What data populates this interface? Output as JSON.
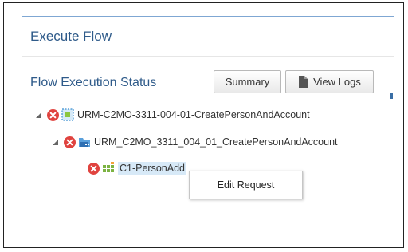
{
  "panel": {
    "title": "Execute Flow"
  },
  "status": {
    "title": "Flow Execution Status",
    "summary_label": "Summary",
    "view_logs_label": "View Logs"
  },
  "tree": {
    "nodes": [
      {
        "label": "URM-C2MO-3311-004-01-CreatePersonAndAccount",
        "icon": "flow-icon",
        "status": "error",
        "expanded": true
      },
      {
        "label": "URM_C2MO_3311_004_01_CreatePersonAndAccount",
        "icon": "folder-icon",
        "status": "error",
        "expanded": true
      },
      {
        "label": "C1-PersonAdd",
        "icon": "grid-icon",
        "status": "error",
        "selected": true
      }
    ]
  },
  "context_menu": {
    "items": [
      "Edit Request"
    ]
  },
  "colors": {
    "title": "#2f5b8a",
    "error": "#e0433f",
    "selection": "#d7e9f7"
  }
}
